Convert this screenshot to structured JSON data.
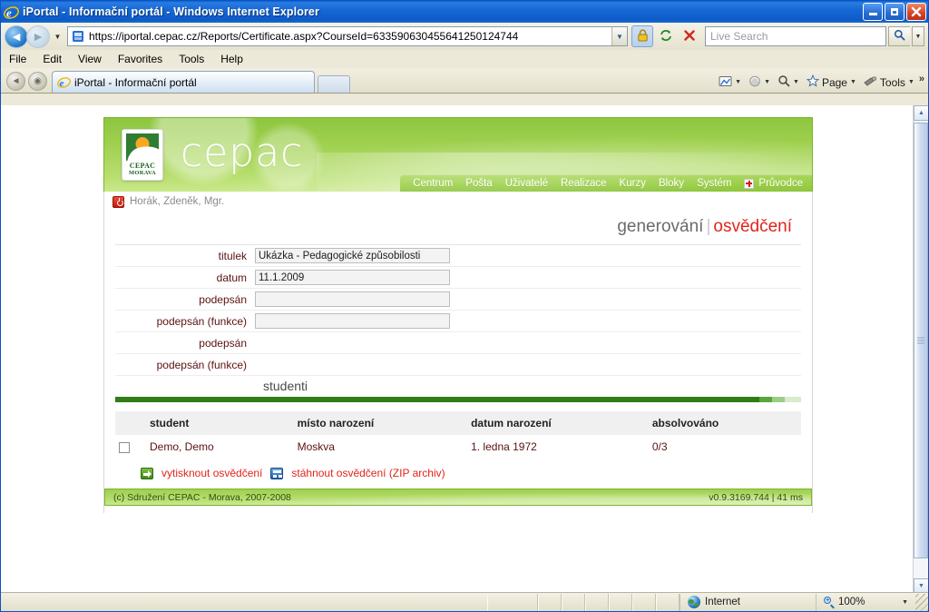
{
  "window": {
    "title": "iPortal - Informační portál - Windows Internet Explorer",
    "minimize_label": "_",
    "maximize_label": "□",
    "close_label": "✕"
  },
  "browser": {
    "address": {
      "url": "https://iportal.cepac.cz/Reports/Certificate.aspx?CourseId=633590630455641250124744",
      "dropdown_caret": "▼"
    },
    "search": {
      "placeholder": "Live Search",
      "value": "",
      "go_icon": "search-icon",
      "dropdown_caret": "▼"
    },
    "nav": {
      "back_glyph": "◄",
      "forward_glyph": "►",
      "history_caret": "▼",
      "lock_icon": "lock-icon",
      "refresh_icon": "refresh-icon",
      "stop_icon": "stop-icon",
      "stop_glyph": "✕"
    },
    "menu": [
      "File",
      "Edit",
      "View",
      "Favorites",
      "Tools",
      "Help"
    ],
    "tabs": [
      {
        "label": "iPortal - Informační portál",
        "active": true
      }
    ],
    "tab_nav": {
      "back_glyph": "◄",
      "forward_glyph": "◉"
    },
    "command_bar": [
      {
        "name": "feeds",
        "label": "",
        "caret": "▼"
      },
      {
        "name": "print",
        "label": "",
        "caret": "▼"
      },
      {
        "name": "search",
        "label": "",
        "caret": "▼"
      },
      {
        "name": "page",
        "label": "Page",
        "caret": "▼"
      },
      {
        "name": "tools",
        "label": "Tools",
        "caret": "▼"
      }
    ],
    "command_overflow": "»"
  },
  "site": {
    "brand": {
      "wordmark": "cepac",
      "logo_line1": "CEPAC",
      "logo_line2": "MORAVA"
    },
    "nav_items": [
      {
        "label": "Centrum"
      },
      {
        "label": "Pošta"
      },
      {
        "label": "Uživatelé"
      },
      {
        "label": "Realizace"
      },
      {
        "label": "Kurzy"
      },
      {
        "label": "Bloky"
      },
      {
        "label": "Systém"
      },
      {
        "label": "Průvodce",
        "icon": "red-plus-icon"
      }
    ],
    "user": {
      "name": "Horák, Zdeněk, Mgr.",
      "logout_icon": "power-icon"
    },
    "page_title": {
      "primary": "generování",
      "separator": "|",
      "accent": "osvědčení"
    },
    "form": {
      "fields": [
        {
          "label": "titulek",
          "value": "Ukázka - Pedagogické způsobilosti",
          "has_input": true
        },
        {
          "label": "datum",
          "value": "11.1.2009",
          "has_input": true
        },
        {
          "label": "podepsán",
          "value": "",
          "has_input": true
        },
        {
          "label": "podepsán (funkce)",
          "value": "",
          "has_input": true
        },
        {
          "label": "podepsán",
          "value": "",
          "has_input": false
        },
        {
          "label": "podepsán (funkce)",
          "value": "",
          "has_input": false
        }
      ],
      "section_label": "studenti"
    },
    "table": {
      "columns": [
        "",
        "student",
        "místo narození",
        "datum narození",
        "absolvováno"
      ],
      "rows": [
        {
          "checked": false,
          "student": "Demo, Demo",
          "birthplace": "Moskva",
          "birthdate": "1. ledna 1972",
          "completed": "0/3"
        }
      ]
    },
    "actions": [
      {
        "label": "vytisknout osvědčení",
        "icon": "print-icon"
      },
      {
        "label": "stáhnout osvědčení (ZIP archiv)",
        "icon": "zip-icon"
      }
    ],
    "footer": {
      "copyright": "(c) Sdružení CEPAC - Morava, 2007-2008",
      "version": "v0.9.3169.744 | 41 ms"
    },
    "colors": {
      "brand_green": "#8dc63f",
      "accent_red": "#e2231a",
      "label_maroon": "#5b1111",
      "bar_dark_green": "#2f7d16"
    }
  },
  "statusbar": {
    "zone": "Internet",
    "zoom": "100%",
    "zoom_caret": "▼"
  },
  "scrollbar": {
    "up_glyph": "▲",
    "down_glyph": "▼"
  }
}
